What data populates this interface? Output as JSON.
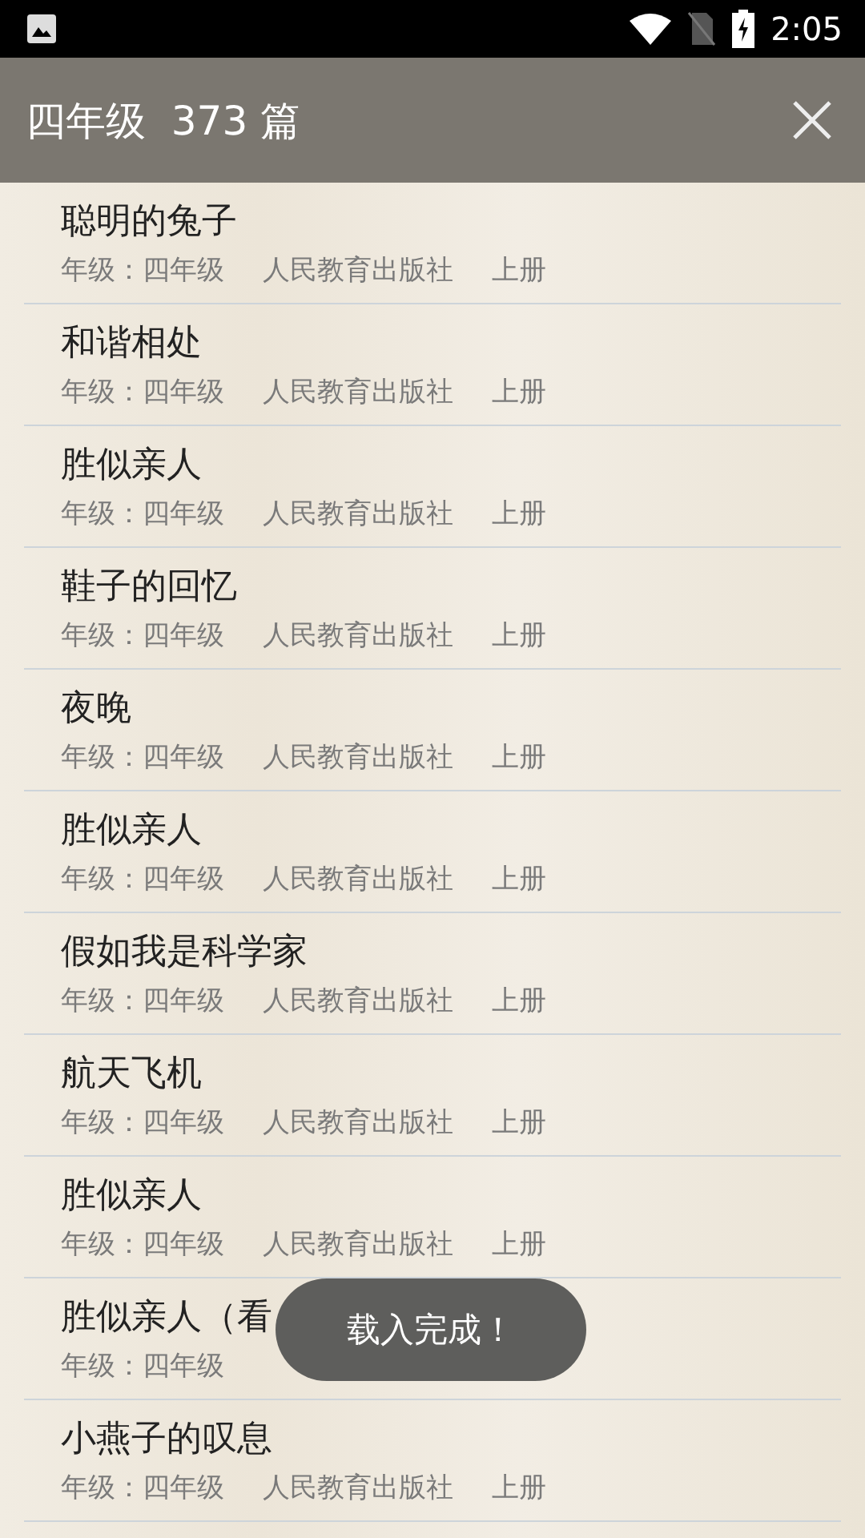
{
  "status_bar": {
    "time": "2:05"
  },
  "app_bar": {
    "title": "四年级  373 篇"
  },
  "items": [
    {
      "title": "聪明的兔子",
      "grade": "年级：四年级",
      "publisher": "人民教育出版社",
      "volume": "上册"
    },
    {
      "title": "和谐相处",
      "grade": "年级：四年级",
      "publisher": "人民教育出版社",
      "volume": "上册"
    },
    {
      "title": "胜似亲人",
      "grade": "年级：四年级",
      "publisher": "人民教育出版社",
      "volume": "上册"
    },
    {
      "title": "鞋子的回忆",
      "grade": "年级：四年级",
      "publisher": "人民教育出版社",
      "volume": "上册"
    },
    {
      "title": "夜晚",
      "grade": "年级：四年级",
      "publisher": "人民教育出版社",
      "volume": "上册"
    },
    {
      "title": "胜似亲人",
      "grade": "年级：四年级",
      "publisher": "人民教育出版社",
      "volume": "上册"
    },
    {
      "title": "假如我是科学家",
      "grade": "年级：四年级",
      "publisher": "人民教育出版社",
      "volume": "上册"
    },
    {
      "title": "航天飞机",
      "grade": "年级：四年级",
      "publisher": "人民教育出版社",
      "volume": "上册"
    },
    {
      "title": "胜似亲人",
      "grade": "年级：四年级",
      "publisher": "人民教育出版社",
      "volume": "上册"
    },
    {
      "title": "胜似亲人（看",
      "grade": "年级：四年级"
    },
    {
      "title": "小燕子的叹息",
      "grade": "年级：四年级",
      "publisher": "人民教育出版社",
      "volume": "上册"
    }
  ],
  "toast": "载入完成！"
}
